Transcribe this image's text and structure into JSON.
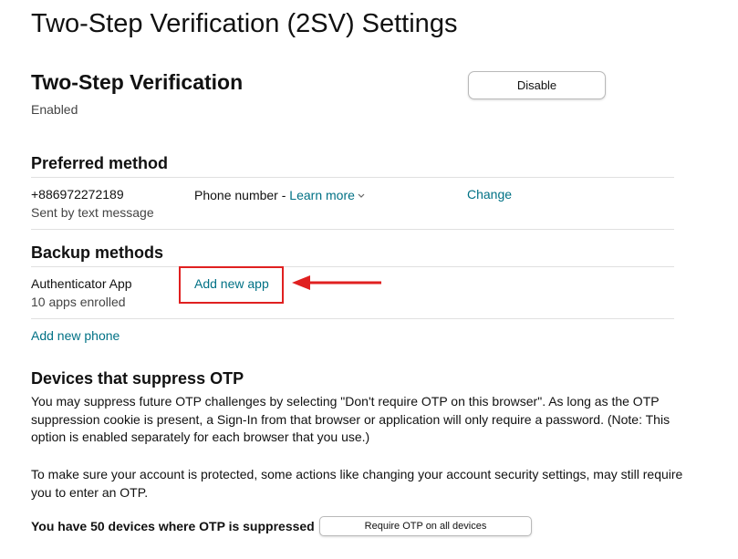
{
  "page": {
    "title": "Two-Step Verification (2SV) Settings"
  },
  "two_step": {
    "heading": "Two-Step Verification",
    "status": "Enabled",
    "disable_label": "Disable"
  },
  "preferred": {
    "heading": "Preferred method",
    "phone": "+886972272189",
    "sub": "Sent by text message",
    "type_label": "Phone number -",
    "learn_more": "Learn more",
    "change_label": "Change"
  },
  "backup": {
    "heading": "Backup methods",
    "app_label": "Authenticator App",
    "app_count": "10 apps enrolled",
    "add_app_label": "Add new app",
    "add_phone_label": "Add new phone",
    "highlight_color": "#e02020"
  },
  "otp": {
    "heading": "Devices that suppress OTP",
    "para1": "You may suppress future OTP challenges by selecting \"Don't require OTP on this browser\". As long as the OTP suppression cookie is present, a Sign-In from that browser or application will only require a password. (Note: This option is enabled separately for each browser that you use.)",
    "para2": "To make sure your account is protected, some actions like changing your account security settings, may still require you to enter an OTP.",
    "devices_text": "You have 50 devices where OTP is suppressed",
    "require_label": "Require OTP on all devices"
  },
  "colors": {
    "link": "#007185",
    "annotation": "#e02020"
  }
}
